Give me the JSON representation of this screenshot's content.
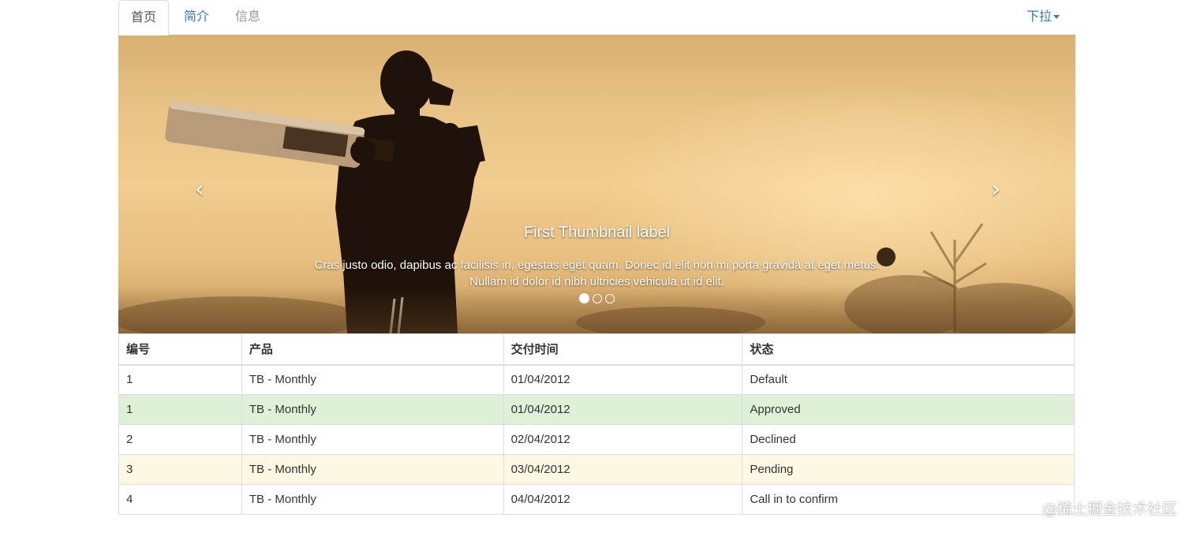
{
  "tabs": [
    {
      "label": "首页",
      "active": true
    },
    {
      "label": "简介",
      "active": false
    },
    {
      "label": "信息",
      "active": false,
      "disabled": true
    }
  ],
  "dropdown": {
    "label": "下拉"
  },
  "carousel": {
    "prev_icon": "chevron-left-icon",
    "next_icon": "chevron-right-icon",
    "caption_title": "First Thumbnail label",
    "caption_line1": "Cras justo odio, dapibus ac facilisis in, egestas eget quam. Donec id elit non mi porta gravida at eget metus.",
    "caption_line2": "Nullam id dolor id nibh ultricies vehicula ut id elit.",
    "indicator_count": 3,
    "active_indicator": 0
  },
  "table": {
    "headers": [
      "编号",
      "产品",
      "交付时间",
      "状态"
    ],
    "rows": [
      {
        "id": "1",
        "product": "TB - Monthly",
        "date": "01/04/2012",
        "status": "Default",
        "style": ""
      },
      {
        "id": "1",
        "product": "TB - Monthly",
        "date": "01/04/2012",
        "status": "Approved",
        "style": "success"
      },
      {
        "id": "2",
        "product": "TB - Monthly",
        "date": "02/04/2012",
        "status": "Declined",
        "style": ""
      },
      {
        "id": "3",
        "product": "TB - Monthly",
        "date": "03/04/2012",
        "status": "Pending",
        "style": "warning"
      },
      {
        "id": "4",
        "product": "TB - Monthly",
        "date": "04/04/2012",
        "status": "Call in to confirm",
        "style": ""
      }
    ]
  },
  "colors": {
    "link": "#337ab7",
    "success_row": "#dff0d8",
    "warning_row": "#fcf8e3",
    "border": "#dddddd"
  },
  "watermark": "@稀土掘金技术社区"
}
